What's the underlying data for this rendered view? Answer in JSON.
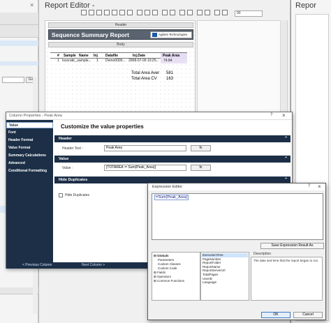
{
  "left_pane": {
    "close_glyph": "×",
    "go_label": "Go"
  },
  "report_editor": {
    "title": "Report Editor -",
    "zoom": "90",
    "bands": {
      "header": "Header",
      "body": "Body"
    },
    "report_title": "Sequence Summary Report",
    "logo_text": "Agilent Technologies",
    "table": {
      "headers": [
        "#",
        "Sample",
        "Name",
        "Inj",
        "Datafile",
        "Inj.Date",
        "Peak Area"
      ],
      "row": [
        "1",
        "Isocratic_sample...",
        "1",
        "Demo0000...",
        "2008-07-09  10:25...",
        "74.84"
      ]
    },
    "totals": [
      {
        "label": "Total Area Aver",
        "value": "581"
      },
      {
        "label": "Total Area CV",
        "value": "163"
      }
    ]
  },
  "right_window": {
    "title": "Repor"
  },
  "column_properties": {
    "title": "Column Properties - Peak Area",
    "nav_items": [
      "Value",
      "Font",
      "Header Format",
      "Value Format",
      "Summary Calculations",
      "Advanced",
      "Conditional Formatting"
    ],
    "active_nav_index": 0,
    "heading": "Customize the value properties",
    "sections": {
      "header": {
        "label": "Header",
        "field_label": "Header Text :",
        "field_value": "Peak Area",
        "fx_label": "fx"
      },
      "value": {
        "label": "Value",
        "field_label": "Value :",
        "field_value": "[TOTAREA := Sum(Peak_Area)]",
        "fx_label": "fx"
      },
      "hide_duplicates": {
        "label": "Hide Duplicates",
        "checkbox_label": "Hide Duplicates"
      }
    },
    "prev_button": "< Previous Column",
    "next_button": "Next Column >",
    "help_glyph": "?",
    "close_glyph": "×"
  },
  "expression_editor": {
    "title": "Expression Editor",
    "expression": "=Sum(Peak_Area)",
    "save_button": "Save Expression Result As",
    "tree": [
      {
        "label": "Globals",
        "bold": true
      },
      {
        "label": "Parameters",
        "bold": false
      },
      {
        "label": "Custom Classes",
        "bold": false
      },
      {
        "label": "Custom Code",
        "bold": false
      },
      {
        "label": "Fields",
        "bold": false
      },
      {
        "label": "Operators",
        "bold": false
      },
      {
        "label": "Common Functions",
        "bold": false
      }
    ],
    "list": [
      "ExecutionTime",
      "PageNumber",
      "ReportFolder",
      "ReportName",
      "ReportServerUrl",
      "TotalPages",
      "UserID",
      "Language"
    ],
    "selected_list_index": 0,
    "description_label": "Description",
    "description": "The date and time that the report began to run.",
    "ok_button": "OK",
    "cancel_button": "Cancel",
    "help_glyph": "?",
    "close_glyph": "×"
  }
}
